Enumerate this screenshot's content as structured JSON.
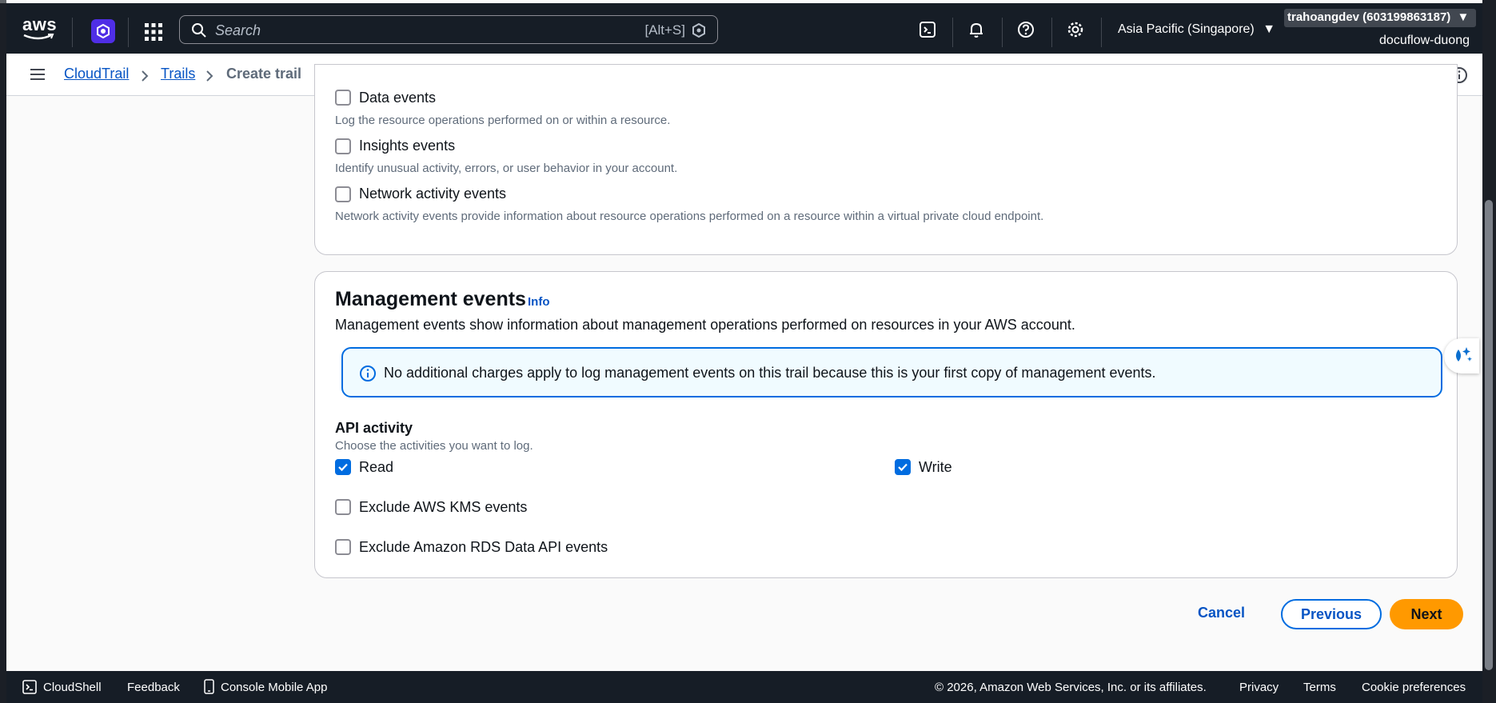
{
  "topnav": {
    "logo_text": "aws",
    "search_placeholder": "Search",
    "search_shortcut": "[Alt+S]",
    "region": "Asia Pacific (Singapore)",
    "account": "trahoangdev (603199863187)",
    "account_name": "docuflow-duong"
  },
  "breadcrumb": {
    "items": [
      "CloudTrail",
      "Trails"
    ],
    "current": "Create trail"
  },
  "event_types": {
    "items": [
      {
        "label": "Data events",
        "desc": "Log the resource operations performed on or within a resource.",
        "checked": false
      },
      {
        "label": "Insights events",
        "desc": "Identify unusual activity, errors, or user behavior in your account.",
        "checked": false
      },
      {
        "label": "Network activity events",
        "desc": "Network activity events provide information about resource operations performed on a resource within a virtual private cloud endpoint.",
        "checked": false
      }
    ]
  },
  "management": {
    "title": "Management events",
    "info": "Info",
    "description": "Management events show information about management operations performed on resources in your AWS account.",
    "alert": "No additional charges apply to log management events on this trail because this is your first copy of management events.",
    "api_title": "API activity",
    "api_desc": "Choose the activities you want to log.",
    "read_label": "Read",
    "write_label": "Write",
    "exclude_kms_label": "Exclude AWS KMS events",
    "exclude_rds_label": "Exclude Amazon RDS Data API events"
  },
  "actions": {
    "cancel": "Cancel",
    "previous": "Previous",
    "next": "Next"
  },
  "footer": {
    "cloudshell": "CloudShell",
    "feedback": "Feedback",
    "mobile_app": "Console Mobile App",
    "copyright": "© 2026, Amazon Web Services, Inc. or its affiliates.",
    "privacy": "Privacy",
    "terms": "Terms",
    "cookies": "Cookie preferences"
  },
  "colors": {
    "nav_bg": "#161d26",
    "link": "#0654c4",
    "primary": "#ff9900",
    "checkbox": "#006ce0"
  }
}
